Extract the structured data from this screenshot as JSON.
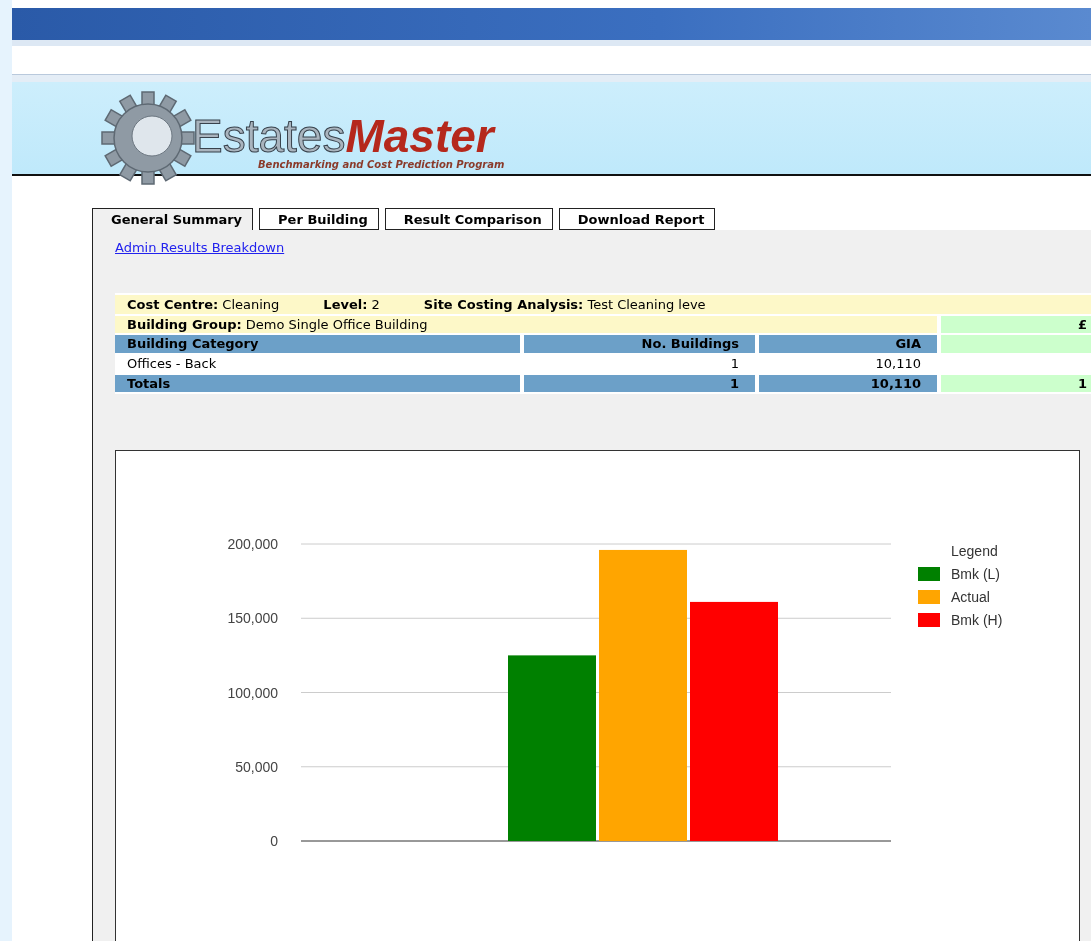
{
  "logo": {
    "name_light": "Estates",
    "name_bold": "Master",
    "tagline": "Benchmarking and Cost Prediction Program"
  },
  "tabs": [
    {
      "label": "General Summary",
      "selected": true
    },
    {
      "label": "Per Building",
      "selected": false
    },
    {
      "label": "Result Comparison",
      "selected": false
    },
    {
      "label": "Download Report",
      "selected": false
    }
  ],
  "admin_link": "Admin Results Breakdown",
  "summary": {
    "info": [
      {
        "label": "Cost Centre:",
        "value": "Cleaning"
      },
      {
        "label": "Level:",
        "value": "2"
      },
      {
        "label": "Site Costing Analysis:",
        "value": "Test Cleaning leve"
      }
    ],
    "group_label": "Building Group:",
    "group_value": "Demo Single Office Building",
    "currency": "£",
    "columns": [
      "Building Category",
      "No. Buildings",
      "GIA"
    ],
    "rows": [
      [
        "Offices - Back",
        "1",
        "10,110"
      ]
    ],
    "totals": [
      "Totals",
      "1",
      "10,110",
      "1"
    ]
  },
  "chart_data": {
    "type": "bar",
    "grid": true,
    "legend": {
      "title": "Legend"
    },
    "ylim": [
      0,
      200000
    ],
    "yticks": [
      {
        "value": 0,
        "label": "0"
      },
      {
        "value": 50000,
        "label": "50,000"
      },
      {
        "value": 100000,
        "label": "100,000"
      },
      {
        "value": 150000,
        "label": "150,000"
      },
      {
        "value": 200000,
        "label": "200,000"
      }
    ],
    "series": [
      {
        "name": "Bmk (L)",
        "color": "#008000",
        "values": [
          125000
        ]
      },
      {
        "name": "Actual",
        "color": "#ffa500",
        "values": [
          196000
        ]
      },
      {
        "name": "Bmk (H)",
        "color": "#ff0000",
        "values": [
          161000
        ]
      }
    ]
  }
}
